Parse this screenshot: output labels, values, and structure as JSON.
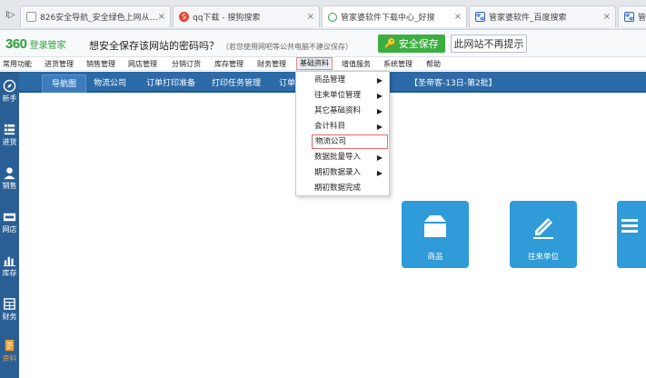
{
  "browser": {
    "nav_glyph": "I▷",
    "tabs": [
      {
        "title": "826安全导航_安全绿色上网从…",
        "icon": "page-icon",
        "close": "×"
      },
      {
        "title": "qq下载 - 搜狗搜索",
        "icon": "sogou-icon",
        "close": "×"
      },
      {
        "title": "管家婆软件下载中心_好搜",
        "icon": "search-q-icon",
        "close": "×"
      },
      {
        "title": "管家婆软件_百度搜索",
        "icon": "baidu-icon",
        "close": "×"
      },
      {
        "title": "管",
        "icon": "baidu-icon",
        "close": ""
      }
    ]
  },
  "password_bar": {
    "logo": "360",
    "logo_sub": "登录管家",
    "message": "想安全保存该网站的密码吗？",
    "hint": "（若您使用网吧等公共电脑不建议保存）",
    "save_button": "安全保存",
    "never_button": "此网站不再提示"
  },
  "menubar": {
    "items": [
      "常用功能",
      "进货管理",
      "销售管理",
      "网店管理",
      "分销订货",
      "库存管理",
      "财务管理",
      "基础资料",
      "增值服务",
      "系统管理",
      "帮助"
    ],
    "active": "基础资料"
  },
  "sidebar": {
    "items": [
      {
        "label": "新手",
        "icon": "compass-icon"
      },
      {
        "label": "进货",
        "icon": "list-icon"
      },
      {
        "label": "销售",
        "icon": "person-icon"
      },
      {
        "label": "网店",
        "icon": "shop-icon"
      },
      {
        "label": "库存",
        "icon": "barchart-icon"
      },
      {
        "label": "财务",
        "icon": "calculator-icon"
      },
      {
        "label": "资料",
        "icon": "document-icon"
      }
    ]
  },
  "page_tabs": {
    "items": [
      "导航图",
      "物流公司",
      "订单打印准备",
      "打印任务管理",
      "订单"
    ],
    "active": "导航图",
    "extra": "【圣帝客-13日-第2批】"
  },
  "dropdown": {
    "items": [
      {
        "label": "商品管理",
        "submenu": true
      },
      {
        "label": "往来单位管理",
        "submenu": true
      },
      {
        "label": "其它基础资料",
        "submenu": true
      },
      {
        "label": "会计科目",
        "submenu": true
      },
      {
        "label": "物流公司",
        "submenu": false,
        "highlight": true
      },
      {
        "label": "数据批量导入",
        "submenu": true
      },
      {
        "label": "期初数据录入",
        "submenu": true
      },
      {
        "label": "期初数据完成",
        "submenu": false
      }
    ],
    "arrow": "▶"
  },
  "tiles": [
    {
      "label": "商品",
      "icon": "box-icon"
    },
    {
      "label": "往来单位",
      "icon": "pen-icon"
    },
    {
      "label": "",
      "icon": "truck-icon"
    }
  ],
  "colors": {
    "sidebar": "#2a5f95",
    "pagetabs": "#2c6aa8",
    "tile": "#2f9bd8",
    "save_green": "#3cae3f",
    "highlight_red": "#e06a6a"
  }
}
